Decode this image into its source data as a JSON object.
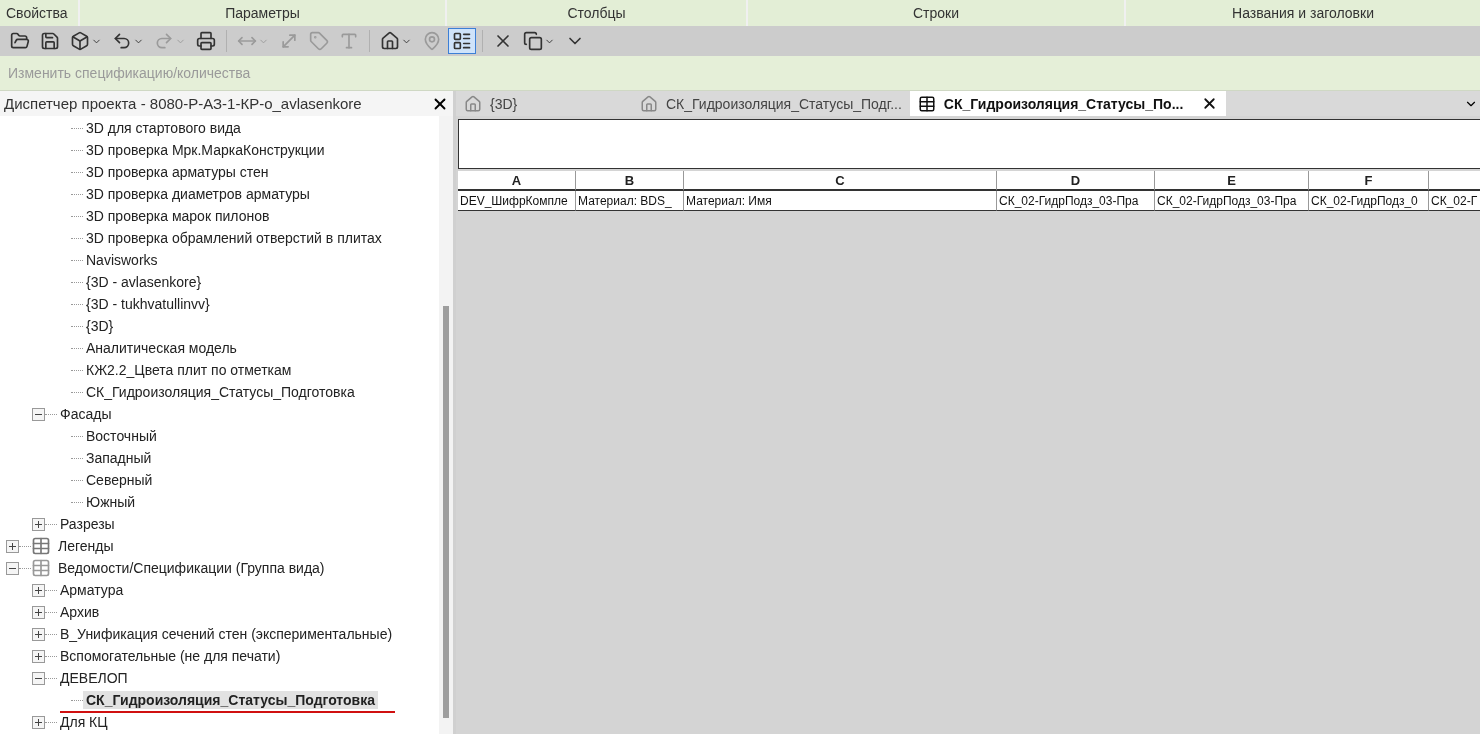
{
  "ribbon_panels": [
    "Свойства",
    "Параметры",
    "Столбцы",
    "Строки",
    "Названия и заголовки"
  ],
  "toolbar": [
    {
      "kind": "open",
      "disabled": false,
      "dropdown": false,
      "selected": false
    },
    {
      "kind": "save",
      "disabled": false,
      "dropdown": false,
      "selected": false
    },
    {
      "kind": "sync",
      "disabled": false,
      "dropdown": true,
      "selected": false
    },
    {
      "kind": "undo",
      "disabled": false,
      "dropdown": true,
      "selected": false
    },
    {
      "kind": "redo",
      "disabled": true,
      "dropdown": true,
      "selected": false
    },
    {
      "kind": "print",
      "disabled": false,
      "dropdown": false,
      "selected": false
    },
    {
      "kind": "measure",
      "disabled": true,
      "dropdown": true,
      "selected": false
    },
    {
      "kind": "dimension",
      "disabled": true,
      "dropdown": false,
      "selected": false
    },
    {
      "kind": "tag",
      "disabled": true,
      "dropdown": false,
      "selected": false
    },
    {
      "kind": "text",
      "disabled": true,
      "dropdown": false,
      "selected": false
    },
    {
      "kind": "house",
      "disabled": false,
      "dropdown": true,
      "selected": false
    },
    {
      "kind": "pin",
      "disabled": true,
      "dropdown": false,
      "selected": false
    },
    {
      "kind": "thinlines",
      "disabled": false,
      "dropdown": false,
      "selected": true
    },
    {
      "kind": "closeviews",
      "disabled": false,
      "dropdown": false,
      "selected": false
    },
    {
      "kind": "switchwindows",
      "disabled": false,
      "dropdown": true,
      "selected": false
    },
    {
      "kind": "customize",
      "disabled": false,
      "dropdown": false,
      "selected": false
    }
  ],
  "context_bar": {
    "label": "Изменить спецификацию/количества",
    "disabled": true
  },
  "project_browser": {
    "title": "Диспетчер проекта - 8080-Р-АЗ-1-КР-о_avlasenkore",
    "tree": [
      {
        "kind": "views",
        "children": [
          {
            "children": [
              {
                "label": "3D для стартового вида",
                "selected": false
              },
              {
                "label": "3D проверка Мрк.МаркаКонструкции",
                "selected": false
              },
              {
                "label": "3D проверка арматуры стен",
                "selected": false
              },
              {
                "label": "3D проверка диаметров арматуры",
                "selected": false
              },
              {
                "label": "3D проверка марок пилонов",
                "selected": false
              },
              {
                "label": "3D проверка обрамлений отверстий в плитах",
                "selected": false
              },
              {
                "label": "Navisworks",
                "selected": false
              },
              {
                "label": "{3D - avlasenkore}",
                "selected": false
              },
              {
                "label": "{3D - tukhvatullinvv}",
                "selected": false
              },
              {
                "label": "{3D}",
                "selected": false
              },
              {
                "label": "Аналитическая модель",
                "selected": false
              },
              {
                "label": "КЖ2.2_Цвета плит по отметкам",
                "selected": false
              },
              {
                "label": "СК_Гидроизоляция_Статусы_Подготовка",
                "selected": false
              }
            ]
          },
          {
            "label": "Фасады",
            "expanded": true,
            "selected": false,
            "children": [
              {
                "label": "Восточный",
                "selected": false
              },
              {
                "label": "Западный",
                "selected": false
              },
              {
                "label": "Северный",
                "selected": false
              },
              {
                "label": "Южный",
                "selected": false
              }
            ]
          },
          {
            "label": "Разрезы",
            "expanded": false,
            "selected": false
          }
        ]
      },
      {
        "kind": "legends",
        "label": "Легенды",
        "expanded": false,
        "selected": false
      },
      {
        "kind": "schedules",
        "label": "Ведомости/Спецификации (Группа вида)",
        "expanded": true,
        "selected": false,
        "children": [
          {
            "label": "Арматура",
            "expanded": false,
            "selected": false
          },
          {
            "label": "Архив",
            "expanded": false,
            "selected": false
          },
          {
            "label": "В_Унификация сечений стен (экспериментальные)",
            "expanded": false,
            "selected": false
          },
          {
            "label": "Вспомогательные (не для печати)",
            "expanded": false,
            "selected": false
          },
          {
            "label": "ДЕВЕЛОП",
            "expanded": true,
            "selected": false,
            "children": [
              {
                "label": "СК_Гидроизоляция_Статусы_Подготовка",
                "selected": true,
                "underlined": true
              }
            ]
          },
          {
            "label": "Для КЦ",
            "expanded": false,
            "selected": false
          }
        ]
      }
    ]
  },
  "tabs": [
    {
      "kind": "model",
      "label": "{3D}",
      "selected": false,
      "closable": false
    },
    {
      "kind": "model",
      "label": "СК_Гидроизоляция_Статусы_Подг...",
      "selected": false,
      "closable": false
    },
    {
      "kind": "schedule",
      "label": "СК_Гидроизоляция_Статусы_По...",
      "selected": true,
      "closable": true
    }
  ],
  "schedule": {
    "columns": [
      {
        "letter": "A",
        "cell": "DEV_ШифрКомпле"
      },
      {
        "letter": "B",
        "cell": "Материал: BDS_"
      },
      {
        "letter": "C",
        "cell": "Материал: Имя"
      },
      {
        "letter": "D",
        "cell": "СК_02-ГидрПодз_03-Пра"
      },
      {
        "letter": "E",
        "cell": "СК_02-ГидрПодз_03-Пра"
      },
      {
        "letter": "F",
        "cell": "СК_02-ГидрПодз_0"
      },
      {
        "cell": "СК_02-Г"
      }
    ]
  }
}
